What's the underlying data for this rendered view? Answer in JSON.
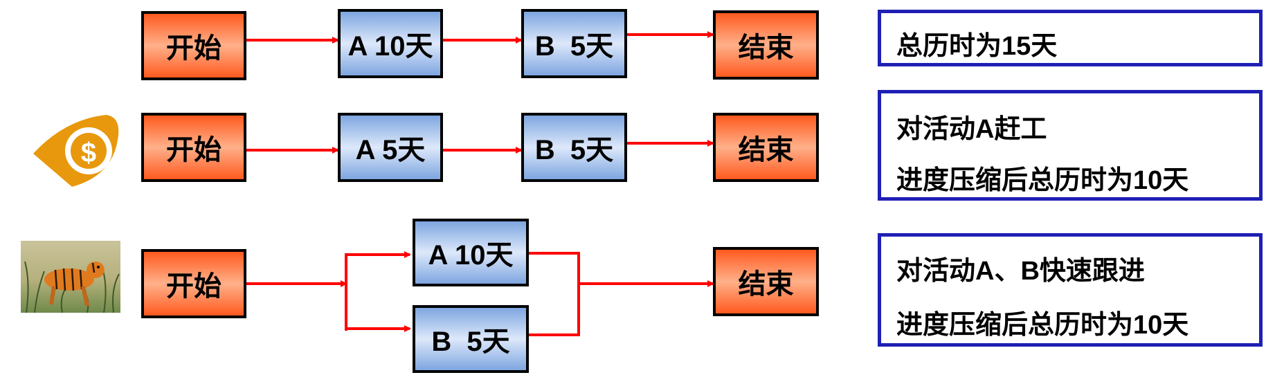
{
  "rows": [
    {
      "start": "开始",
      "a": "A 10天",
      "b": "B  5天",
      "end": "结束",
      "note": [
        "总历时为15天"
      ]
    },
    {
      "start": "开始",
      "a": "A 5天",
      "b": "B  5天",
      "end": "结束",
      "note": [
        "对活动A赶工",
        "进度压缩后总历时为10天"
      ],
      "icon": "money-eye-icon"
    },
    {
      "start": "开始",
      "a": "A 10天",
      "b": "B  5天",
      "end": "结束",
      "note": [
        "对活动A、B快速跟进",
        "进度压缩后总历时为10天"
      ],
      "icon": "tiger-image"
    }
  ],
  "colors": {
    "start_end_fill": "#ff5a1f",
    "activity_fill": "#7ea6e0",
    "arrow": "#ff0000",
    "note_border": "#1f1fb4"
  }
}
